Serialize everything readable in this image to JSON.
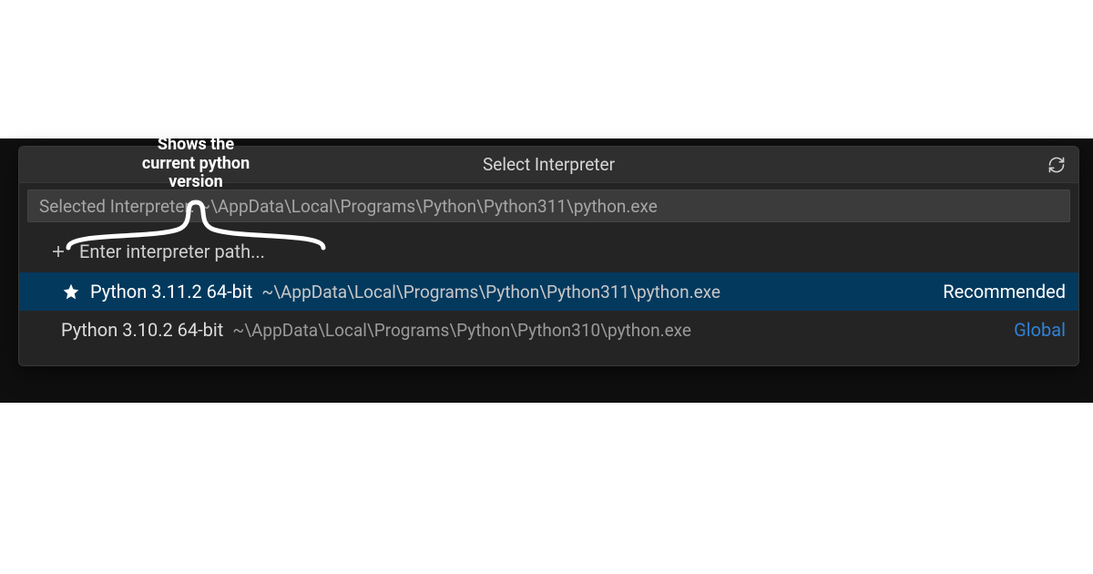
{
  "header": {
    "title": "Select Interpreter"
  },
  "input": {
    "placeholder": "Selected Interpreter: ~\\AppData\\Local\\Programs\\Python\\Python311\\python.exe"
  },
  "enter_path": {
    "label": "Enter interpreter path..."
  },
  "interpreters": [
    {
      "name": "Python 3.11.2 64-bit",
      "path": "~\\AppData\\Local\\Programs\\Python\\Python311\\python.exe",
      "tag": "Recommended",
      "tag_class": "recommended",
      "selected": true,
      "starred": true
    },
    {
      "name": "Python 3.10.2 64-bit",
      "path": "~\\AppData\\Local\\Programs\\Python\\Python310\\python.exe",
      "tag": "Global",
      "tag_class": "global",
      "selected": false,
      "starred": false
    }
  ],
  "annotation": {
    "line1": "Shows the",
    "line2": "current python",
    "line3": "version"
  }
}
